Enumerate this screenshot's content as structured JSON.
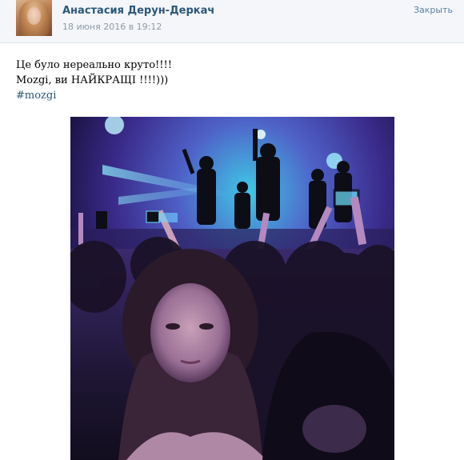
{
  "post": {
    "author": {
      "name": "Анастасия Дерун-Деркач",
      "avatar_icon": "user-avatar"
    },
    "date": "18 июня 2016 в 19:12",
    "close_label": "Закрыть",
    "text_lines": [
      "Це було нереально круто!!!!",
      "Mozgi, ви НАЙКРАЩІ !!!!)))"
    ],
    "hashtag": "#mozgi",
    "photo": {
      "description_icon": "concert-photo"
    }
  },
  "colors": {
    "link": "#2b587a",
    "header_bg": "#f4f6f9",
    "meta": "#8e9aa6"
  }
}
